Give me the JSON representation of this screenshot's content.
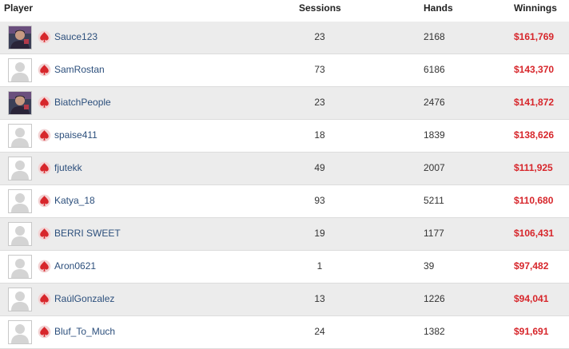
{
  "columns": {
    "player": "Player",
    "sessions": "Sessions",
    "hands": "Hands",
    "winnings": "Winnings"
  },
  "accent_colors": {
    "winnings": "#d7262b",
    "player_link": "#2c4f7c",
    "row_alt": "#ececec"
  },
  "rows": [
    {
      "avatar": "photo-avatar",
      "player": "Sauce123",
      "sessions": "23",
      "hands": "2168",
      "winnings": "$161,769"
    },
    {
      "avatar": "default-avatar",
      "player": "SamRostan",
      "sessions": "73",
      "hands": "6186",
      "winnings": "$143,370"
    },
    {
      "avatar": "photo-avatar",
      "player": "BiatchPeople",
      "sessions": "23",
      "hands": "2476",
      "winnings": "$141,872"
    },
    {
      "avatar": "default-avatar",
      "player": "spaise411",
      "sessions": "18",
      "hands": "1839",
      "winnings": "$138,626"
    },
    {
      "avatar": "default-avatar",
      "player": "fjutekk",
      "sessions": "49",
      "hands": "2007",
      "winnings": "$111,925"
    },
    {
      "avatar": "default-avatar",
      "player": "Katya_18",
      "sessions": "93",
      "hands": "5211",
      "winnings": "$110,680"
    },
    {
      "avatar": "default-avatar",
      "player": "BERRI SWEET",
      "sessions": "19",
      "hands": "1177",
      "winnings": "$106,431"
    },
    {
      "avatar": "default-avatar",
      "player": "Aron0621",
      "sessions": "1",
      "hands": "39",
      "winnings": "$97,482"
    },
    {
      "avatar": "default-avatar",
      "player": "RaúlGonzalez",
      "sessions": "13",
      "hands": "1226",
      "winnings": "$94,041"
    },
    {
      "avatar": "default-avatar",
      "player": "Bluf_To_Much",
      "sessions": "24",
      "hands": "1382",
      "winnings": "$91,691"
    }
  ]
}
